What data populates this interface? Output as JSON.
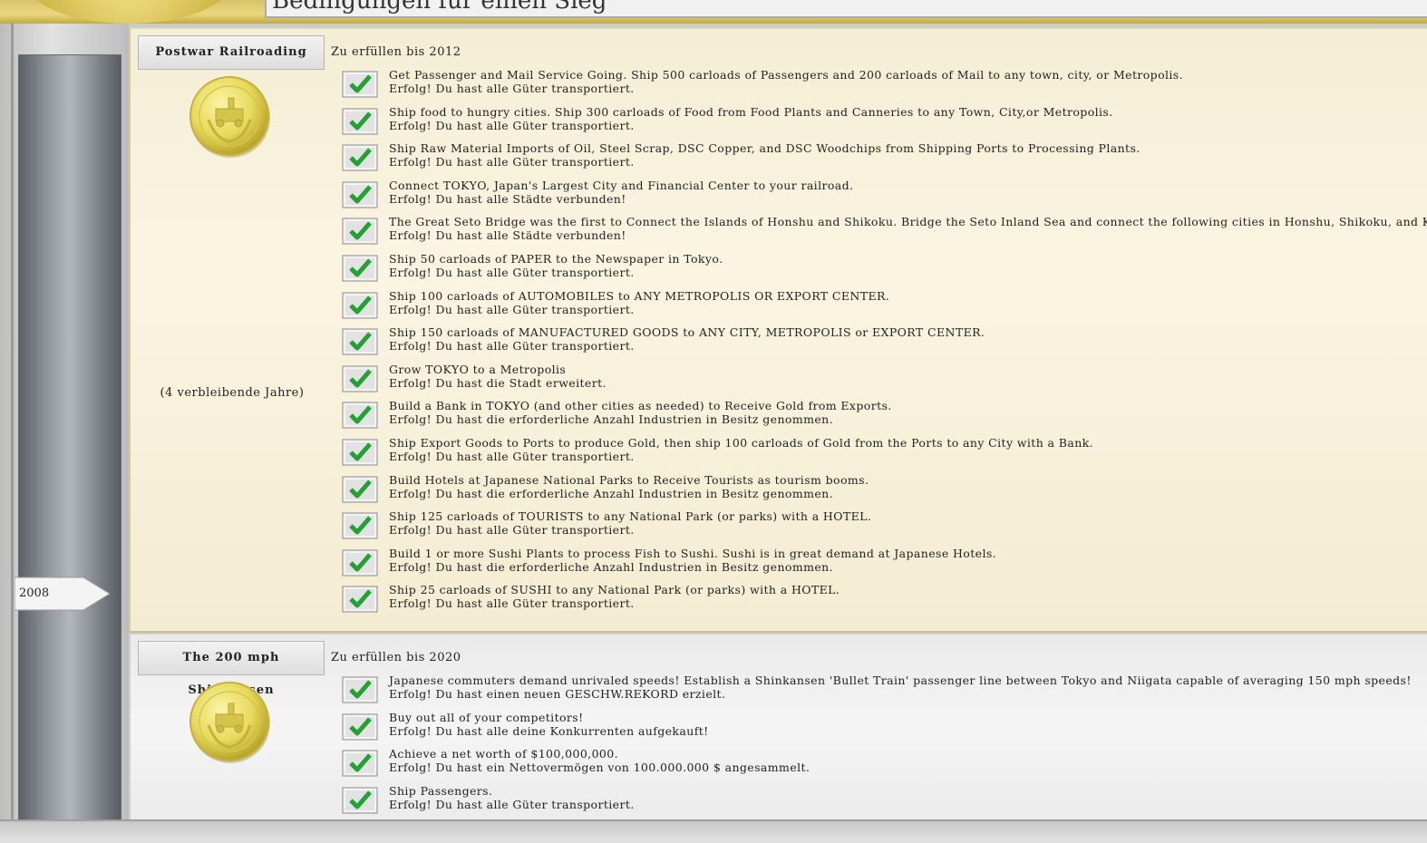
{
  "header": {
    "title": "Bedingungen für einen Sieg"
  },
  "timeline": {
    "year_label": "2008"
  },
  "chapters": [
    {
      "title": "Postwar Railroading",
      "deadline": "Zu erfüllen bis 2012",
      "remaining": "(4 verbleibende Jahre)",
      "goals": [
        {
          "text": "Get Passenger and Mail Service Going.  Ship 500 carloads of Passengers and 200 carloads of Mail to any town, city, or Metropolis.",
          "status": "Erfolg! Du hast alle Güter transportiert."
        },
        {
          "text": "Ship food to hungry cities.  Ship 300 carloads of Food from Food Plants and Canneries to any Town, City,or Metropolis.",
          "status": "Erfolg! Du hast alle Güter transportiert."
        },
        {
          "text": "Ship Raw Material Imports of Oil, Steel Scrap, DSC Copper, and DSC Woodchips from Shipping Ports to Processing Plants.",
          "status": "Erfolg! Du hast alle Güter transportiert."
        },
        {
          "text": "Connect TOKYO, Japan's Largest City and Financial Center to your railroad.",
          "status": "Erfolg! Du hast alle Städte verbunden!"
        },
        {
          "text": "The Great Seto Bridge was the first to Connect the Islands of Honshu and Shikoku.  Bridge the Seto Inland Sea and connect the following cities in Honshu, Shikoku, and Kyushu.",
          "status": "Erfolg! Du hast alle Städte verbunden!"
        },
        {
          "text": "Ship 50 carloads of PAPER to the Newspaper in Tokyo.",
          "status": "Erfolg! Du hast alle Güter transportiert."
        },
        {
          "text": "Ship 100 carloads of AUTOMOBILES to ANY METROPOLIS OR EXPORT CENTER.",
          "status": "Erfolg! Du hast alle Güter transportiert."
        },
        {
          "text": "Ship 150 carloads of MANUFACTURED GOODS to ANY CITY, METROPOLIS or EXPORT CENTER.",
          "status": "Erfolg! Du hast alle Güter transportiert."
        },
        {
          "text": "Grow TOKYO to a Metropolis",
          "status": "Erfolg! Du hast die Stadt erweitert."
        },
        {
          "text": "Build a Bank in TOKYO (and other cities as needed) to Receive Gold from Exports.",
          "status": "Erfolg! Du hast die erforderliche Anzahl Industrien in Besitz genommen."
        },
        {
          "text": "Ship Export Goods to Ports to produce Gold, then ship 100 carloads of Gold from the Ports to any City with a Bank.",
          "status": "Erfolg! Du hast alle Güter transportiert."
        },
        {
          "text": "Build Hotels at Japanese National Parks to Receive Tourists as tourism booms.",
          "status": "Erfolg! Du hast die erforderliche Anzahl Industrien in Besitz genommen."
        },
        {
          "text": "Ship 125 carloads of TOURISTS to any National Park (or parks) with a HOTEL.",
          "status": "Erfolg! Du hast alle Güter transportiert."
        },
        {
          "text": "Build 1 or more Sushi Plants to process Fish to Sushi.  Sushi is in great demand at Japanese Hotels.",
          "status": "Erfolg! Du hast die erforderliche Anzahl Industrien in Besitz genommen."
        },
        {
          "text": "Ship 25 carloads of SUSHI to any National Park (or parks) with a HOTEL.",
          "status": "Erfolg! Du hast alle Güter transportiert."
        }
      ]
    },
    {
      "title": "The 200 mph Shinkansen",
      "deadline": "Zu erfüllen bis 2020",
      "goals": [
        {
          "text": "Japanese commuters demand unrivaled speeds!  Establish a Shinkansen 'Bullet Train' passenger line between Tokyo and Niigata capable of averaging 150 mph speeds!",
          "status": "Erfolg! Du hast einen neuen GESCHW.REKORD erzielt."
        },
        {
          "text": "Buy out all of your competitors!",
          "status": "Erfolg! Du hast alle deine Konkurrenten aufgekauft!"
        },
        {
          "text": "Achieve a net worth of $100,000,000.",
          "status": "Erfolg! Du hast ein Nettovermögen von 100.000.000 $ angesammelt."
        },
        {
          "text": "Ship Passengers.",
          "status": "Erfolg! Du hast alle Güter transportiert."
        }
      ]
    }
  ]
}
